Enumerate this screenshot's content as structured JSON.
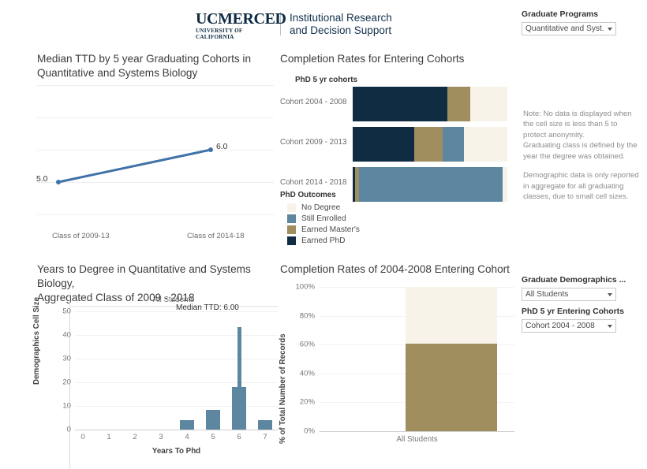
{
  "header": {
    "logo_main": "UCMERCED",
    "logo_sub": "UNIVERSITY OF CALIFORNIA",
    "dept": "Institutional Research\nand Decision Support"
  },
  "filters": {
    "programs": {
      "label": "Graduate Programs",
      "value": "Quantitative and Syst..."
    },
    "demographics": {
      "label": "Graduate Demographics ...",
      "value": "All Students"
    },
    "cohorts": {
      "label": "PhD 5 yr Entering Cohorts",
      "value": "Cohort 2004 - 2008"
    }
  },
  "note": {
    "paragraph1": "Note: No data is displayed when the cell size is less than 5 to protect anonymity.\nGraduating class is defined by the year the degree was obtained.",
    "paragraph2": "Demographic data is only reported in aggregate for all graduating classes, due to small cell sizes."
  },
  "legend": {
    "title": "PhD Outcomes",
    "items": [
      {
        "label": "No Degree",
        "color": "#f7f3e8"
      },
      {
        "label": "Still Enrolled",
        "color": "#5d87a1"
      },
      {
        "label": "Earned Master's",
        "color": "#a08e5e"
      },
      {
        "label": "Earned PhD",
        "color": "#0f2c42"
      }
    ]
  },
  "chart_data": [
    {
      "id": "median_ttd_line",
      "type": "line",
      "title": "Median TTD by 5 year Graduating Cohorts in\nQuantitative and Systems Biology",
      "categories": [
        "Class of 2009-13",
        "Class of 2014-18"
      ],
      "values": [
        5.0,
        6.0
      ],
      "point_labels": [
        "5.0",
        "6.0"
      ],
      "xlabel": "",
      "ylabel": "",
      "ylim": [
        3.5,
        7.5
      ],
      "grid": true,
      "color": "#3f72a8"
    },
    {
      "id": "completion_rates_cohorts",
      "type": "bar",
      "orientation": "horizontal",
      "stacked": true,
      "title": "Completion Rates for Entering Cohorts",
      "axis_title": "PhD 5 yr cohorts",
      "categories": [
        "Cohort 2004 - 2008",
        "Cohort 2009 - 2013",
        "Cohort 2014 - 2018"
      ],
      "series": [
        {
          "name": "Earned PhD",
          "color": "#0f2c42",
          "values": [
            61,
            40,
            1.5
          ]
        },
        {
          "name": "Earned Master's",
          "color": "#a08e5e",
          "values": [
            15,
            18,
            2.5
          ]
        },
        {
          "name": "Still Enrolled",
          "color": "#5d87a1",
          "values": [
            0,
            14,
            93
          ]
        },
        {
          "name": "No Degree",
          "color": "#f7f3e8",
          "values": [
            24,
            28,
            3
          ]
        }
      ],
      "xlim": [
        0,
        100
      ],
      "grid": true
    },
    {
      "id": "years_to_degree_hist",
      "type": "bar",
      "title": "Years to Degree in Quantitative and Systems Biology,\nAggregated Class of 2009 - 2018",
      "panel_label": "All Students",
      "annotation": "Median TTD: 6.00",
      "categories": [
        "0",
        "1",
        "2",
        "3",
        "4",
        "5",
        "6",
        "7"
      ],
      "values": [
        0,
        0,
        0,
        0,
        4,
        8.5,
        18,
        4
      ],
      "reference_spike": {
        "category": "6",
        "value": 43.5
      },
      "xlabel": "Years To Phd",
      "ylabel": "Demographics Cell Size",
      "yticks": [
        0,
        10,
        20,
        30,
        40,
        50
      ],
      "ylim": [
        0,
        52
      ],
      "grid": true,
      "color": "#5d87a1"
    },
    {
      "id": "completion_rates_2004",
      "type": "bar",
      "stacked": true,
      "title": "Completion Rates of 2004-2008 Entering Cohort",
      "categories": [
        "All Students"
      ],
      "series": [
        {
          "name": "Earned Master's",
          "color": "#a08e5e",
          "values": [
            60.5
          ]
        },
        {
          "name": "No Degree",
          "color": "#f7f3e8",
          "values": [
            39.5
          ]
        }
      ],
      "ylabel": "% of Total Number of Records",
      "yticks": [
        "0%",
        "20%",
        "40%",
        "60%",
        "80%",
        "100%"
      ],
      "ylim": [
        0,
        100
      ],
      "grid": true
    }
  ]
}
